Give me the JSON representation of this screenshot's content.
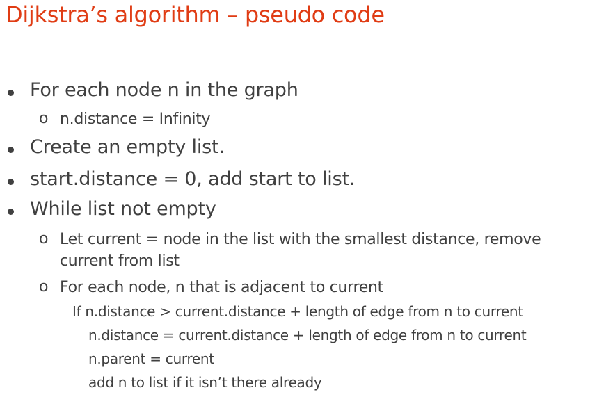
{
  "slide": {
    "title": "Dijkstra’s algorithm – pseudo code",
    "bullet_marker_l2": "o",
    "items": [
      "For each node n in the graph",
      "n.distance = Infinity",
      "Create an empty list.",
      "start.distance = 0, add start to list.",
      "While list not empty",
      "Let current = node in the list with the smallest distance, remove",
      "current from list",
      "For each node, n that is adjacent to current",
      "If n.distance > current.distance + length of edge from n to current",
      "n.distance = current.distance + length of edge from n to current",
      "n.parent = current",
      "add n to list if it isn’t there already"
    ]
  }
}
